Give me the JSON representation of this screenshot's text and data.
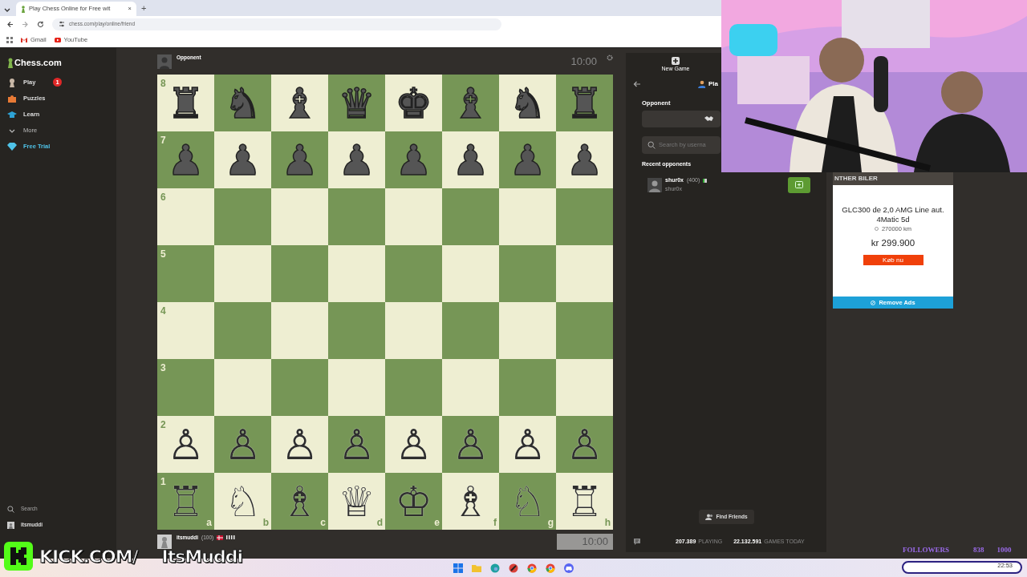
{
  "browser": {
    "tab_title": "Play Chess Online for Free wit",
    "tab_close": "×",
    "new_tab": "+",
    "url": "chess.com/play/online/friend",
    "bookmarks": [
      "Gmail",
      "YouTube"
    ]
  },
  "sidebar": {
    "logo": "Chess.com",
    "items": [
      {
        "label": "Play",
        "badge": "1",
        "kind": "pawn",
        "color": "#c8b7a6"
      },
      {
        "label": "Puzzles",
        "kind": "puzzle",
        "color": "#e87a35"
      },
      {
        "label": "Learn",
        "kind": "cap",
        "color": "#2ea3d6"
      },
      {
        "label": "More",
        "kind": "more",
        "color": "#bbbbbb"
      },
      {
        "label": "Free Trial",
        "kind": "diamond",
        "color": "#4fc3e8"
      }
    ],
    "bottom": [
      {
        "label": "Search",
        "kind": "search"
      },
      {
        "label": "itsmuddi",
        "kind": "avatar"
      }
    ]
  },
  "opponent": {
    "name": "Opponent",
    "clock": "10:00"
  },
  "board": {
    "files": [
      "a",
      "b",
      "c",
      "d",
      "e",
      "f",
      "g",
      "h"
    ],
    "ranks": [
      {
        "label": "8",
        "squares": [
          {
            "piece": "♜",
            "white": false
          },
          {
            "piece": "♞",
            "white": false
          },
          {
            "piece": "♝",
            "white": false
          },
          {
            "piece": "♛",
            "white": false
          },
          {
            "piece": "♚",
            "white": false
          },
          {
            "piece": "♝",
            "white": false
          },
          {
            "piece": "♞",
            "white": false
          },
          {
            "piece": "♜",
            "white": false
          }
        ]
      },
      {
        "label": "7",
        "squares": [
          {
            "piece": "♟",
            "white": false
          },
          {
            "piece": "♟",
            "white": false
          },
          {
            "piece": "♟",
            "white": false
          },
          {
            "piece": "♟",
            "white": false
          },
          {
            "piece": "♟",
            "white": false
          },
          {
            "piece": "♟",
            "white": false
          },
          {
            "piece": "♟",
            "white": false
          },
          {
            "piece": "♟",
            "white": false
          }
        ]
      },
      {
        "label": "6"
      },
      {
        "label": "5"
      },
      {
        "label": "4"
      },
      {
        "label": "3"
      },
      {
        "label": "2",
        "squares": [
          {
            "piece": "♙",
            "white": true
          },
          {
            "piece": "♙",
            "white": true
          },
          {
            "piece": "♙",
            "white": true
          },
          {
            "piece": "♙",
            "white": true
          },
          {
            "piece": "♙",
            "white": true
          },
          {
            "piece": "♙",
            "white": true
          },
          {
            "piece": "♙",
            "white": true
          },
          {
            "piece": "♙",
            "white": true
          }
        ]
      },
      {
        "label": "1",
        "squares": [
          {
            "piece": "♖",
            "white": true
          },
          {
            "piece": "♘",
            "white": true
          },
          {
            "piece": "♗",
            "white": true
          },
          {
            "piece": "♕",
            "white": true
          },
          {
            "piece": "♔",
            "white": true
          },
          {
            "piece": "♗",
            "white": true
          },
          {
            "piece": "♘",
            "white": true
          },
          {
            "piece": "♖",
            "white": true
          }
        ]
      }
    ]
  },
  "player": {
    "name": "itsmuddi",
    "rating": "(100)",
    "clock": "10:00"
  },
  "panel": {
    "new_game": "New Game",
    "title": "Pla",
    "opponent_label": "Opponent",
    "search_placeholder": "Search by userna",
    "recent_label": "Recent opponents",
    "recent": [
      {
        "name": "shur0x",
        "rating": "(400)",
        "username": "shur0x"
      }
    ],
    "find_friends": "Find Friends",
    "stats": [
      {
        "value": "207.389",
        "label": "PLAYING"
      },
      {
        "value": "22.132.591",
        "label": "GAMES TODAY"
      }
    ]
  },
  "ad": {
    "header": "NTHER BILER",
    "title": "GLC300 de 2,0 AMG Line aut. 4Matic 5d",
    "km": "270000 km",
    "price": "kr 299.900",
    "cta": "Køb nu",
    "remove": "Remove Ads"
  },
  "overlay": {
    "kick": "KICK.COM/",
    "handle": "ItsMuddi",
    "followers": "FOLLOWERS",
    "count": "838",
    "goal": "1000"
  },
  "taskbar": {
    "icons": [
      {
        "kind": "windows",
        "color": "#1a73e8"
      },
      {
        "kind": "folder",
        "color": "#f2c230"
      },
      {
        "kind": "edge",
        "color": "#1fa0a0"
      },
      {
        "kind": "app",
        "color": "#d9413a"
      },
      {
        "kind": "chrome",
        "color": "#e44134"
      },
      {
        "kind": "chrome",
        "color": "#e44134"
      },
      {
        "kind": "discord",
        "color": "#5865f2"
      }
    ],
    "time": "22:53"
  }
}
